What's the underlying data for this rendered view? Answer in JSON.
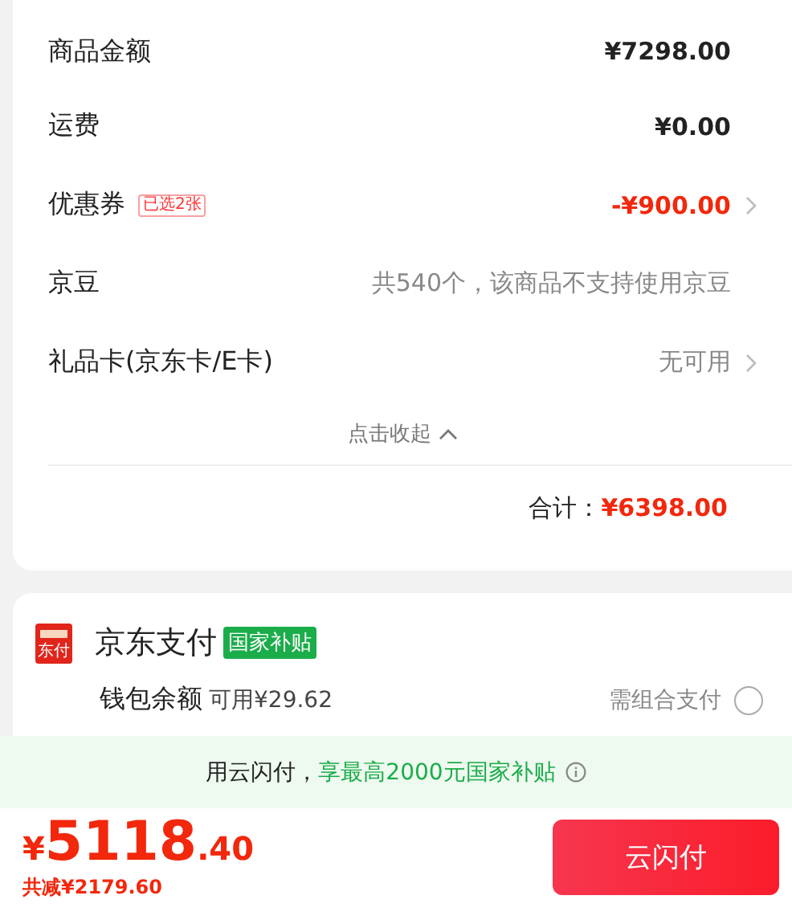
{
  "summary": {
    "rows": [
      {
        "label": "商品金额",
        "value": "¥7298.00",
        "kind": "amount",
        "arrow": false
      },
      {
        "label": "运费",
        "value": "¥0.00",
        "kind": "amount",
        "arrow": false
      },
      {
        "label": "优惠券",
        "badge": "已选2张",
        "value": "-¥900.00",
        "kind": "discount",
        "arrow": true
      },
      {
        "label": "京豆",
        "value": "共540个，该商品不支持使用京豆",
        "kind": "note",
        "arrow": false
      },
      {
        "label": "礼品卡(京东卡/E卡)",
        "value": "无可用",
        "kind": "note",
        "arrow": true
      }
    ],
    "collapse": {
      "label": "点击收起",
      "expanded": true
    },
    "total_label": "合计：",
    "total": "¥6398.00"
  },
  "payment": {
    "icon_text": "东付",
    "title": "京东支付",
    "badge": "国家补贴",
    "wallet": {
      "label": "钱包余额",
      "available": "可用¥29.62",
      "hint": "需组合支付",
      "selected": false
    }
  },
  "banner": {
    "prefix": "用云闪付，",
    "highlight": "享最高2000元国家补贴"
  },
  "footer": {
    "currency": "¥",
    "integer": "5118",
    "decimals": ".40",
    "saving": "共减¥2179.60",
    "pay_button": "云闪付"
  }
}
